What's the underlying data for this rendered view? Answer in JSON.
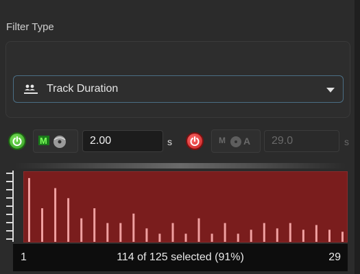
{
  "panel": {
    "title": "Filter Type",
    "dropdown": {
      "icon": "people-line-icon",
      "selected": "Track Duration"
    }
  },
  "controls": {
    "min_enabled_icon": "power-green-icon",
    "min_mode_icon": "m-disc-icon",
    "min_value": "2.00",
    "min_unit": "s",
    "max_enabled_icon": "power-red-icon",
    "max_mode_icon": "m-disc-a-icon",
    "max_value": "29.0",
    "max_unit": "s"
  },
  "histogram": {
    "range_min": "1",
    "range_max": "29",
    "status": "114 of 125 selected (91%)",
    "bars": [
      0.95,
      0.5,
      0.8,
      0.65,
      0.35,
      0.5,
      0.28,
      0.28,
      0.42,
      0.2,
      0.12,
      0.28,
      0.12,
      0.35,
      0.12,
      0.28,
      0.12,
      0.18,
      0.28,
      0.2,
      0.28,
      0.18,
      0.25,
      0.18,
      0.15
    ],
    "colors": {
      "fill": "#7a1d1d",
      "bar": "#f0a0a0"
    }
  }
}
